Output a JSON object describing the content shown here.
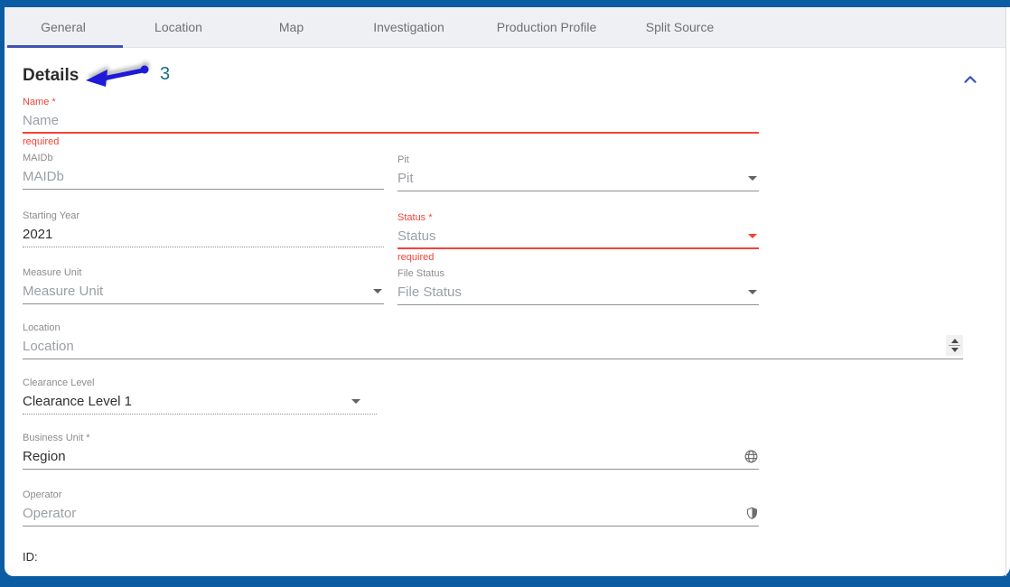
{
  "tabs": {
    "items": [
      {
        "label": "General",
        "active": true
      },
      {
        "label": "Location",
        "active": false
      },
      {
        "label": "Map",
        "active": false
      },
      {
        "label": "Investigation",
        "active": false
      },
      {
        "label": "Production Profile",
        "active": false
      },
      {
        "label": "Split Source",
        "active": false
      }
    ]
  },
  "section": {
    "title": "Details",
    "annotation_number": "3",
    "collapse_icon": "chevron-up"
  },
  "fields": {
    "name": {
      "label": "Name *",
      "placeholder": "Name",
      "error": "required"
    },
    "maidb": {
      "label": "MAIDb",
      "placeholder": "MAIDb"
    },
    "pit": {
      "label": "Pit",
      "placeholder": "Pit"
    },
    "starting_year": {
      "label": "Starting Year",
      "value": "2021"
    },
    "status": {
      "label": "Status *",
      "placeholder": "Status",
      "error": "required"
    },
    "measure_unit": {
      "label": "Measure Unit",
      "placeholder": "Measure Unit"
    },
    "file_status": {
      "label": "File Status",
      "placeholder": "File Status"
    },
    "location": {
      "label": "Location",
      "placeholder": "Location"
    },
    "clearance_level": {
      "label": "Clearance Level",
      "value": "Clearance Level 1"
    },
    "business_unit": {
      "label": "Business Unit *",
      "value": "Region"
    },
    "operator": {
      "label": "Operator",
      "placeholder": "Operator"
    }
  },
  "footer": {
    "id_label": "ID:"
  },
  "icons": {
    "dropdown": "triangle-down",
    "collapse": "chevron-up",
    "business_unit_suffix": "globe",
    "operator_suffix": "shield",
    "location_suffix": "number-spinner"
  },
  "colors": {
    "frame_blue": "#0c5ca3",
    "tabbar_gray": "#eef0f3",
    "active_tab_ink": "#3f51b5",
    "error_red": "#f44336",
    "annotation_arrow_blue": "#1f1ad8",
    "annotation_number_teal": "#176b86"
  }
}
